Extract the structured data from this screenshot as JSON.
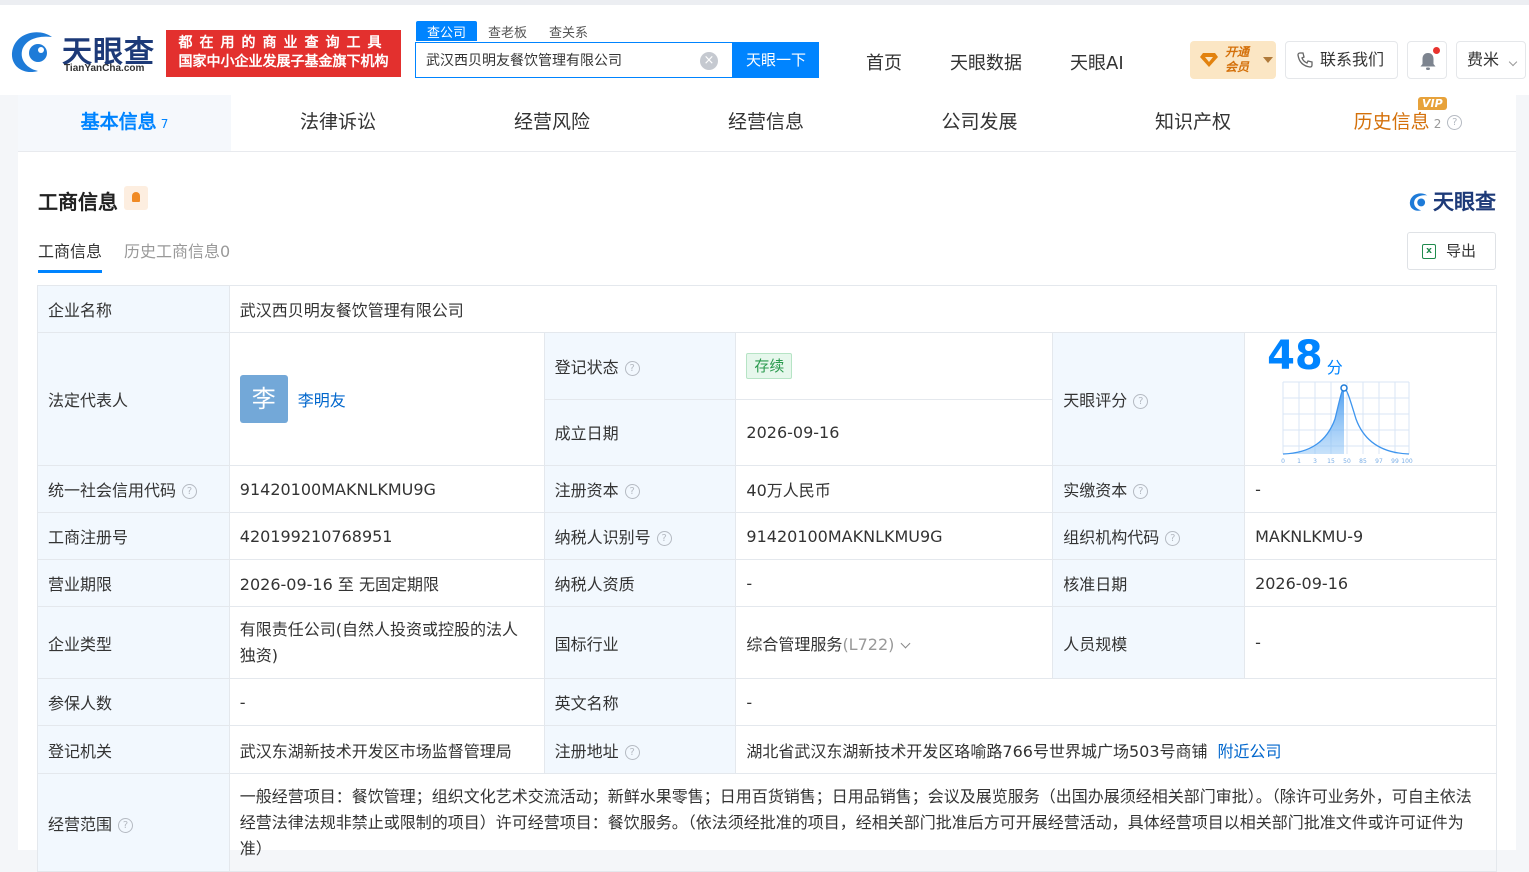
{
  "header": {
    "logo_text": "天眼查",
    "logo_sub": "TianYanCha.com",
    "slogan_line1": "都在用的商业查询工具",
    "slogan_line2": "国家中小企业发展子基金旗下机构",
    "search_tabs": [
      "查公司",
      "查老板",
      "查关系"
    ],
    "search_value": "武汉西贝明友餐饮管理有限公司",
    "search_button": "天眼一下",
    "nav": [
      "首页",
      "天眼数据",
      "天眼AI"
    ],
    "vip_line1": "开通",
    "vip_line2": "会员",
    "contact": "联系我们",
    "user": "费米"
  },
  "tabs": [
    {
      "label": "基本信息",
      "count": "7"
    },
    {
      "label": "法律诉讼"
    },
    {
      "label": "经营风险"
    },
    {
      "label": "经营信息"
    },
    {
      "label": "公司发展"
    },
    {
      "label": "知识产权"
    },
    {
      "label": "历史信息",
      "count": "2",
      "badge": "VIP"
    }
  ],
  "section": {
    "title": "工商信息",
    "brand": "天眼查",
    "subtabs": [
      "工商信息",
      "历史工商信息0"
    ],
    "export": "导出"
  },
  "info": {
    "company_name_label": "企业名称",
    "company_name": "武汉西贝明友餐饮管理有限公司",
    "legal_rep_label": "法定代表人",
    "legal_rep_avatar": "李",
    "legal_rep": "李明友",
    "reg_status_label": "登记状态",
    "reg_status": "存续",
    "founded_label": "成立日期",
    "founded": "2026-09-16",
    "score_label": "天眼评分",
    "score": "48",
    "score_unit": "分",
    "score_ticks": [
      "0",
      "1",
      "3",
      "15",
      "50",
      "85",
      "97",
      "99",
      "100"
    ],
    "credit_code_label": "统一社会信用代码",
    "credit_code": "91420100MAKNLKMU9G",
    "reg_capital_label": "注册资本",
    "reg_capital": "40万人民币",
    "paid_capital_label": "实缴资本",
    "paid_capital": "-",
    "reg_no_label": "工商注册号",
    "reg_no": "420199210768951",
    "taxpayer_id_label": "纳税人识别号",
    "taxpayer_id": "91420100MAKNLKMU9G",
    "org_code_label": "组织机构代码",
    "org_code": "MAKNLKMU-9",
    "term_label": "营业期限",
    "term": "2026-09-16 至 无固定期限",
    "taxpayer_qual_label": "纳税人资质",
    "taxpayer_qual": "-",
    "approve_date_label": "核准日期",
    "approve_date": "2026-09-16",
    "type_label": "企业类型",
    "type": "有限责任公司(自然人投资或控股的法人独资)",
    "industry_label": "国标行业",
    "industry": "综合管理服务",
    "industry_code": "(L722)",
    "staff_size_label": "人员规模",
    "staff_size": "-",
    "insured_label": "参保人数",
    "insured": "-",
    "english_name_label": "英文名称",
    "english_name": "-",
    "authority_label": "登记机关",
    "authority": "武汉东湖新技术开发区市场监督管理局",
    "address_label": "注册地址",
    "address": "湖北省武汉东湖新技术开发区珞喻路766号世界城广场503号商铺",
    "nearby_link": "附近公司",
    "scope_label": "经营范围",
    "scope": "一般经营项目：餐饮管理；组织文化艺术交流活动；新鲜水果零售；日用百货销售；日用品销售；会议及展览服务（出国办展须经相关部门审批）。（除许可业务外，可自主依法经营法律法规非禁止或限制的项目）许可经营项目：餐饮服务。（依法须经批准的项目，经相关部门批准后方可开展经营活动，具体经营项目以相关部门批准文件或许可证件为准）"
  },
  "colors": {
    "accent": "#0084ff",
    "brand_red": "#e3302e",
    "status_green": "#2a9a4e",
    "vip_orange": "#d4700a"
  }
}
